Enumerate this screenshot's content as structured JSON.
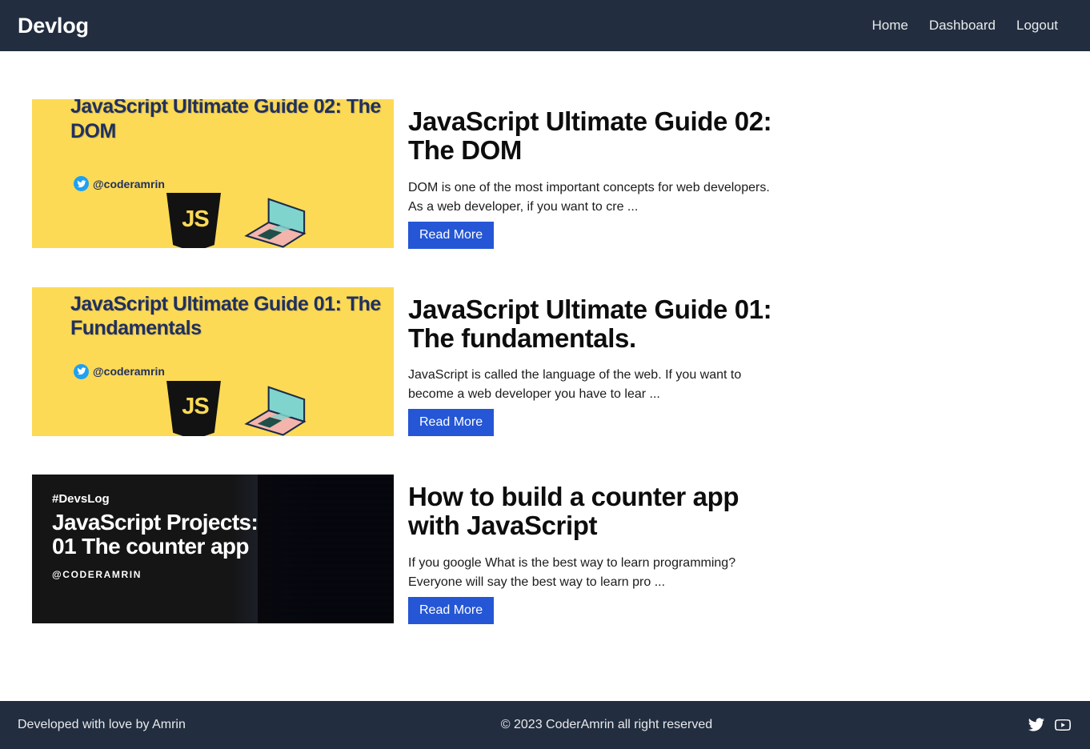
{
  "header": {
    "brand": "Devlog",
    "nav": [
      {
        "label": "Home",
        "name": "nav-link-home"
      },
      {
        "label": "Dashboard",
        "name": "nav-link-dashboard"
      },
      {
        "label": "Logout",
        "name": "nav-link-logout"
      }
    ]
  },
  "posts": [
    {
      "title": "JavaScript Ultimate Guide 02: The DOM",
      "excerpt": "DOM is one of the most important concepts for web developers. As a web developer, if you want to cre ...",
      "read_more": "Read More",
      "thumb_style": "yellow",
      "thumb_text": {
        "title": "JavaScript Ultimate Guide 02: The DOM",
        "handle": "@coderamrin",
        "logo": "JS"
      }
    },
    {
      "title": "JavaScript Ultimate Guide 01: The fundamentals.",
      "excerpt": "JavaScript is called the language of the web. If you want to become a web developer you have to lear ...",
      "read_more": "Read More",
      "thumb_style": "yellow",
      "thumb_text": {
        "title": "JavaScript Ultimate Guide 01: The Fundamentals",
        "handle": "@coderamrin",
        "logo": "JS"
      }
    },
    {
      "title": "How to build a counter app with JavaScript",
      "excerpt": "If you google What is the best way to learn programming? Everyone will say the best way to learn pro ...",
      "read_more": "Read More",
      "thumb_style": "dark",
      "thumb_text": {
        "tag": "#DevsLog",
        "title": "JavaScript Projects: 01 The counter app",
        "handle": "@CODERAMRIN"
      }
    }
  ],
  "footer": {
    "left": "Developed with love by Amrin",
    "center": "© 2023 CoderAmrin all right reserved",
    "socials": [
      {
        "name": "twitter-icon",
        "label": "Twitter"
      },
      {
        "name": "youtube-icon",
        "label": "YouTube"
      }
    ]
  },
  "colors": {
    "header_bg": "#222e3f",
    "accent_blue": "#2456d6",
    "banner_yellow": "#fcda56",
    "banner_dark": "#151515",
    "text_light": "#e8eaed"
  }
}
